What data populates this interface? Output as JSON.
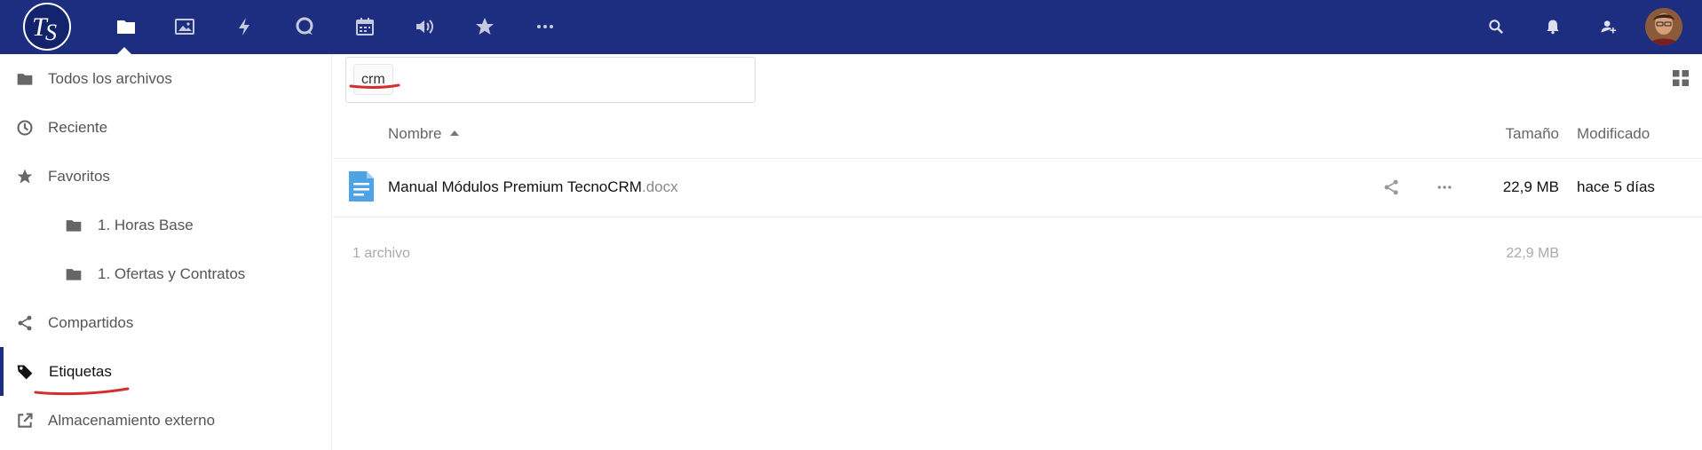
{
  "header": {
    "logo_text": "TS",
    "apps": [
      {
        "name": "files-icon"
      },
      {
        "name": "photos-icon"
      },
      {
        "name": "activity-icon"
      },
      {
        "name": "talk-icon"
      },
      {
        "name": "calendar-icon"
      },
      {
        "name": "audio-icon"
      },
      {
        "name": "favorites-icon"
      },
      {
        "name": "more-apps-icon"
      }
    ],
    "right_icons": [
      "search-icon",
      "notifications-icon",
      "contacts-icon"
    ],
    "colors": {
      "bar": "#1d2e80",
      "accent_red": "#d32f2f"
    }
  },
  "sidebar": {
    "items": [
      {
        "label": "Todos los archivos",
        "icon": "folder-icon"
      },
      {
        "label": "Reciente",
        "icon": "clock-icon"
      },
      {
        "label": "Favoritos",
        "icon": "star-icon"
      },
      {
        "label": "1. Horas Base",
        "icon": "folder-icon"
      },
      {
        "label": "1. Ofertas y Contratos",
        "icon": "folder-icon"
      },
      {
        "label": "Compartidos",
        "icon": "share-icon"
      },
      {
        "label": "Etiquetas",
        "icon": "tag-icon",
        "active": true
      },
      {
        "label": "Almacenamiento externo",
        "icon": "external-link-icon"
      }
    ]
  },
  "main": {
    "filter": {
      "tag": "crm",
      "placeholder": ""
    },
    "columns": {
      "name": "Nombre",
      "size": "Tamaño",
      "modified": "Modificado"
    },
    "files": [
      {
        "basename": "Manual Módulos Premium TecnoCRM",
        "extension": ".docx",
        "size": "22,9 MB",
        "modified": "hace 5 días",
        "icon": "document-icon"
      }
    ],
    "summary": {
      "count": "1 archivo",
      "size": "22,9 MB"
    }
  }
}
